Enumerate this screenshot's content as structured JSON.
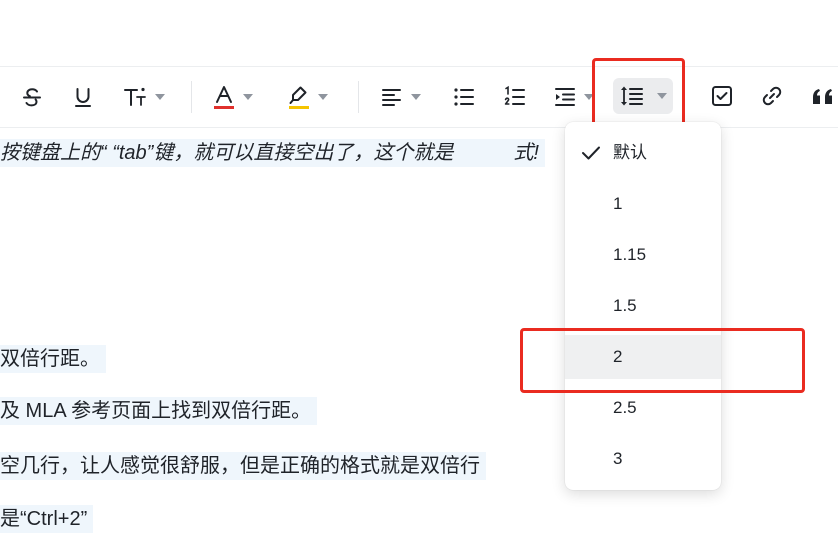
{
  "editor": {
    "lines": [
      "按键盘上的“ “tab”键，就可以直接空出了，这个就是",
      "双倍行距。",
      "及 MLA 参考页面上找到双倍行距。",
      "空几行，让人感觉很舒服，但是正确的格式就是双倍行",
      "是“Ctrl+2”"
    ],
    "overflow_tail": "式!"
  },
  "toolbar": {
    "icons": [
      "strikethrough-icon",
      "underline-icon",
      "font-size-icon",
      "text-color-icon",
      "highlight-icon",
      "align-icon",
      "bullet-list-icon",
      "numbered-list-icon",
      "indent-icon",
      "line-spacing-icon",
      "checkbox-icon",
      "link-icon",
      "quote-icon"
    ],
    "text_color": "#e0302c",
    "highlight_color": "#f5c400"
  },
  "line_spacing_menu": {
    "selected": "默认",
    "hovered": "2",
    "options": [
      "默认",
      "1",
      "1.15",
      "1.5",
      "2",
      "2.5",
      "3"
    ]
  },
  "colors": {
    "highlight_box": "#ea2b20",
    "text_bg": "#eff6fc"
  }
}
